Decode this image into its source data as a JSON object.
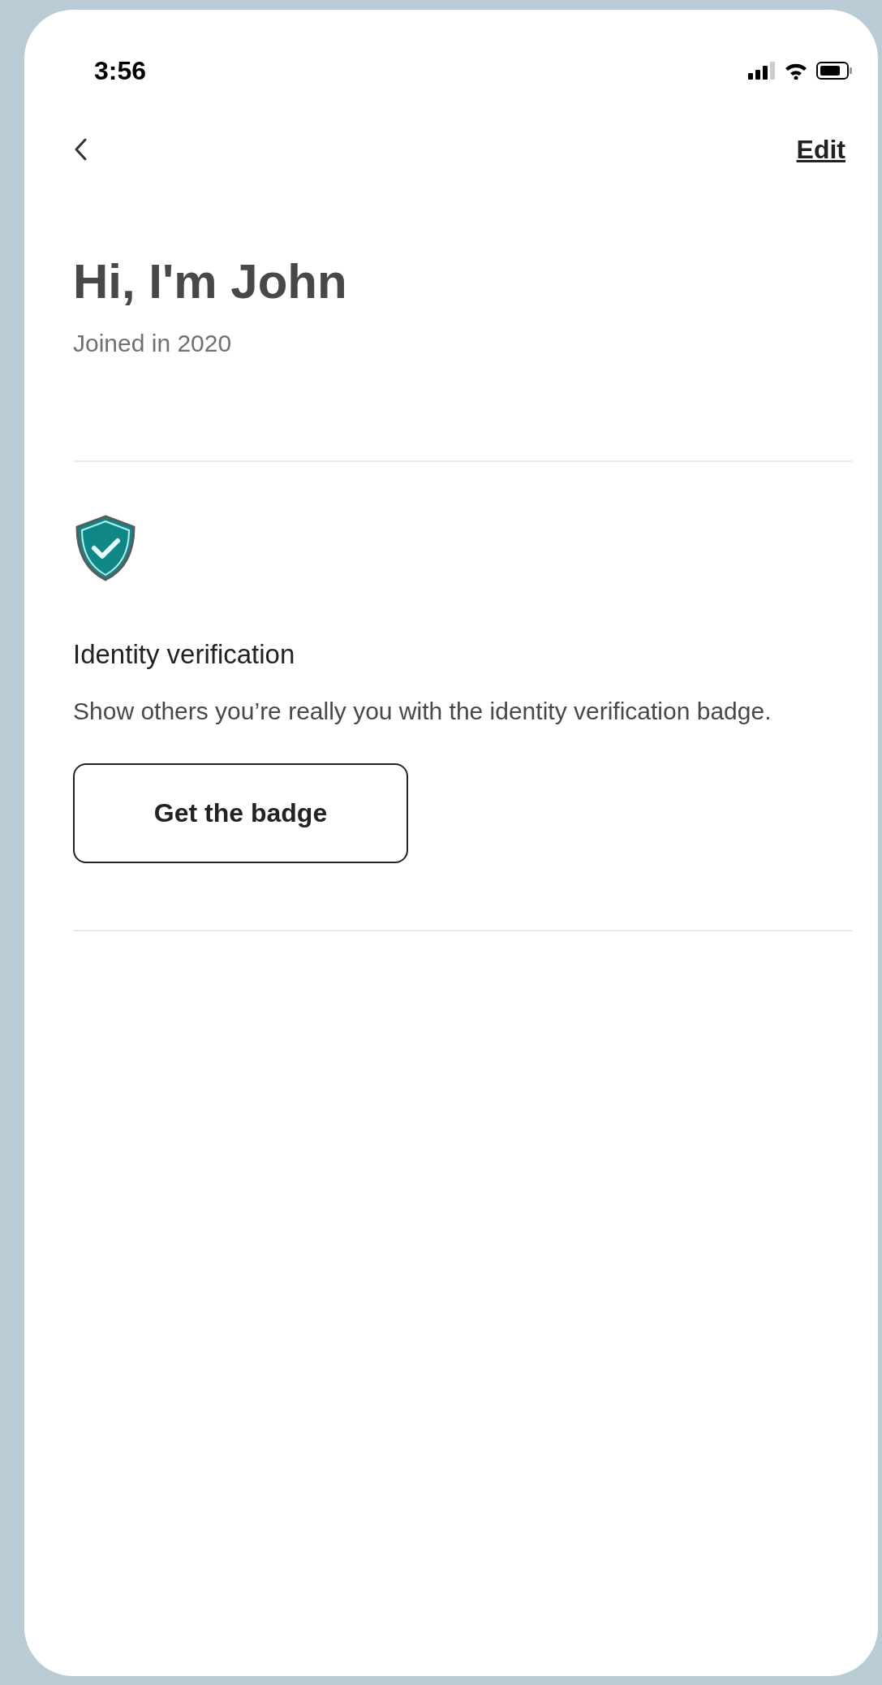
{
  "status_bar": {
    "time": "3:56"
  },
  "nav": {
    "action": "Edit"
  },
  "profile": {
    "title": "Hi, I'm John",
    "subtitle": "Joined in 2020"
  },
  "verification": {
    "title": "Identity verification",
    "text": "Show others you’re really you with the identity verification badge.",
    "button": "Get the badge"
  }
}
